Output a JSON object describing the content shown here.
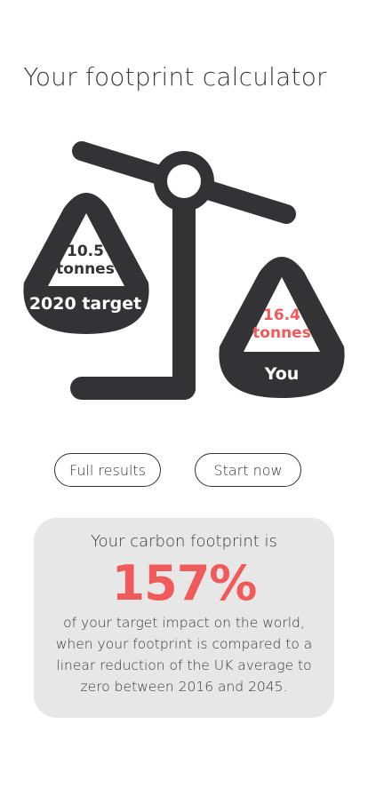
{
  "page": {
    "title": "Your footprint calculator"
  },
  "scale": {
    "icon": "balance-scale-icon",
    "target": {
      "value": "10.5 tonnes",
      "label": "2020 target"
    },
    "you": {
      "value": "16.4 tonnes",
      "label": "You"
    }
  },
  "actions": {
    "full_results_label": "Full results",
    "start_now_label": "Start now"
  },
  "summary": {
    "heading": "Your carbon footprint is",
    "percent": "157%",
    "body": "of your target impact on the world, when your footprint is compared to a linear reduction of the UK average to zero between 2016 and 2045."
  },
  "colors": {
    "dark": "#333335",
    "accent": "#f15a5b",
    "card_background": "#e7e7e7"
  }
}
